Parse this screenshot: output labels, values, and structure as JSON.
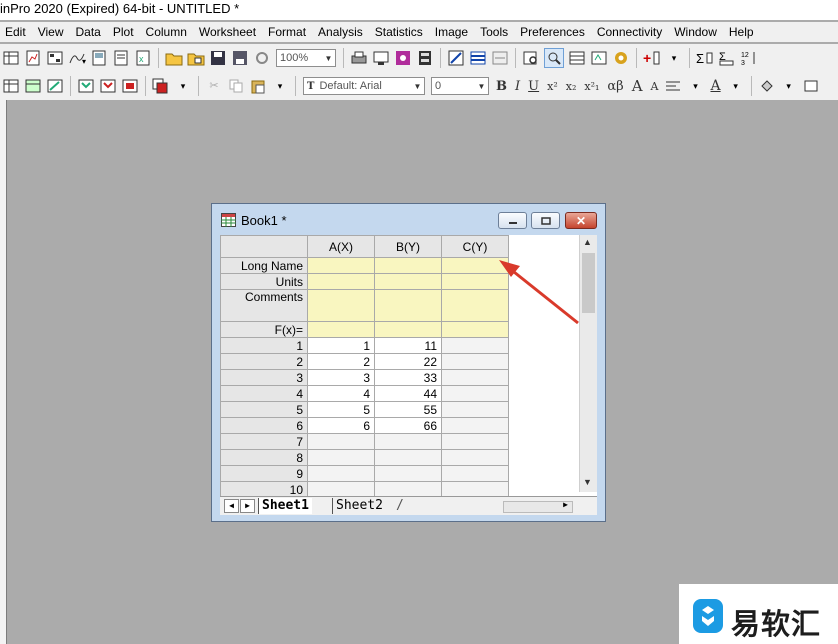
{
  "window": {
    "title": "inPro 2020 (Expired) 64-bit - UNTITLED *"
  },
  "menu": [
    "Edit",
    "View",
    "Data",
    "Plot",
    "Column",
    "Worksheet",
    "Format",
    "Analysis",
    "Statistics",
    "Image",
    "Tools",
    "Preferences",
    "Connectivity",
    "Window",
    "Help"
  ],
  "toolbar": {
    "zoom": "100%",
    "font_name": "Default: Arial",
    "font_size": "0"
  },
  "book": {
    "title": "Book1 *",
    "columns": [
      "A(X)",
      "B(Y)",
      "C(Y)"
    ],
    "header_rows": [
      "Long Name",
      "Units",
      "Comments",
      "F(x)="
    ],
    "rows": [
      {
        "n": "1",
        "a": "1",
        "b": "11"
      },
      {
        "n": "2",
        "a": "2",
        "b": "22"
      },
      {
        "n": "3",
        "a": "3",
        "b": "33"
      },
      {
        "n": "4",
        "a": "4",
        "b": "44"
      },
      {
        "n": "5",
        "a": "5",
        "b": "55"
      },
      {
        "n": "6",
        "a": "6",
        "b": "66"
      },
      {
        "n": "7",
        "a": "",
        "b": ""
      },
      {
        "n": "8",
        "a": "",
        "b": ""
      },
      {
        "n": "9",
        "a": "",
        "b": ""
      },
      {
        "n": "10",
        "a": "",
        "b": ""
      }
    ],
    "sheets": [
      "Sheet1",
      "Sheet2"
    ]
  },
  "watermark": {
    "text": "易软汇"
  },
  "colors": {
    "accent_arrow": "#d93a2b",
    "header_yellow": "#f9f6c0",
    "window_frame": "#c4d8ee"
  }
}
